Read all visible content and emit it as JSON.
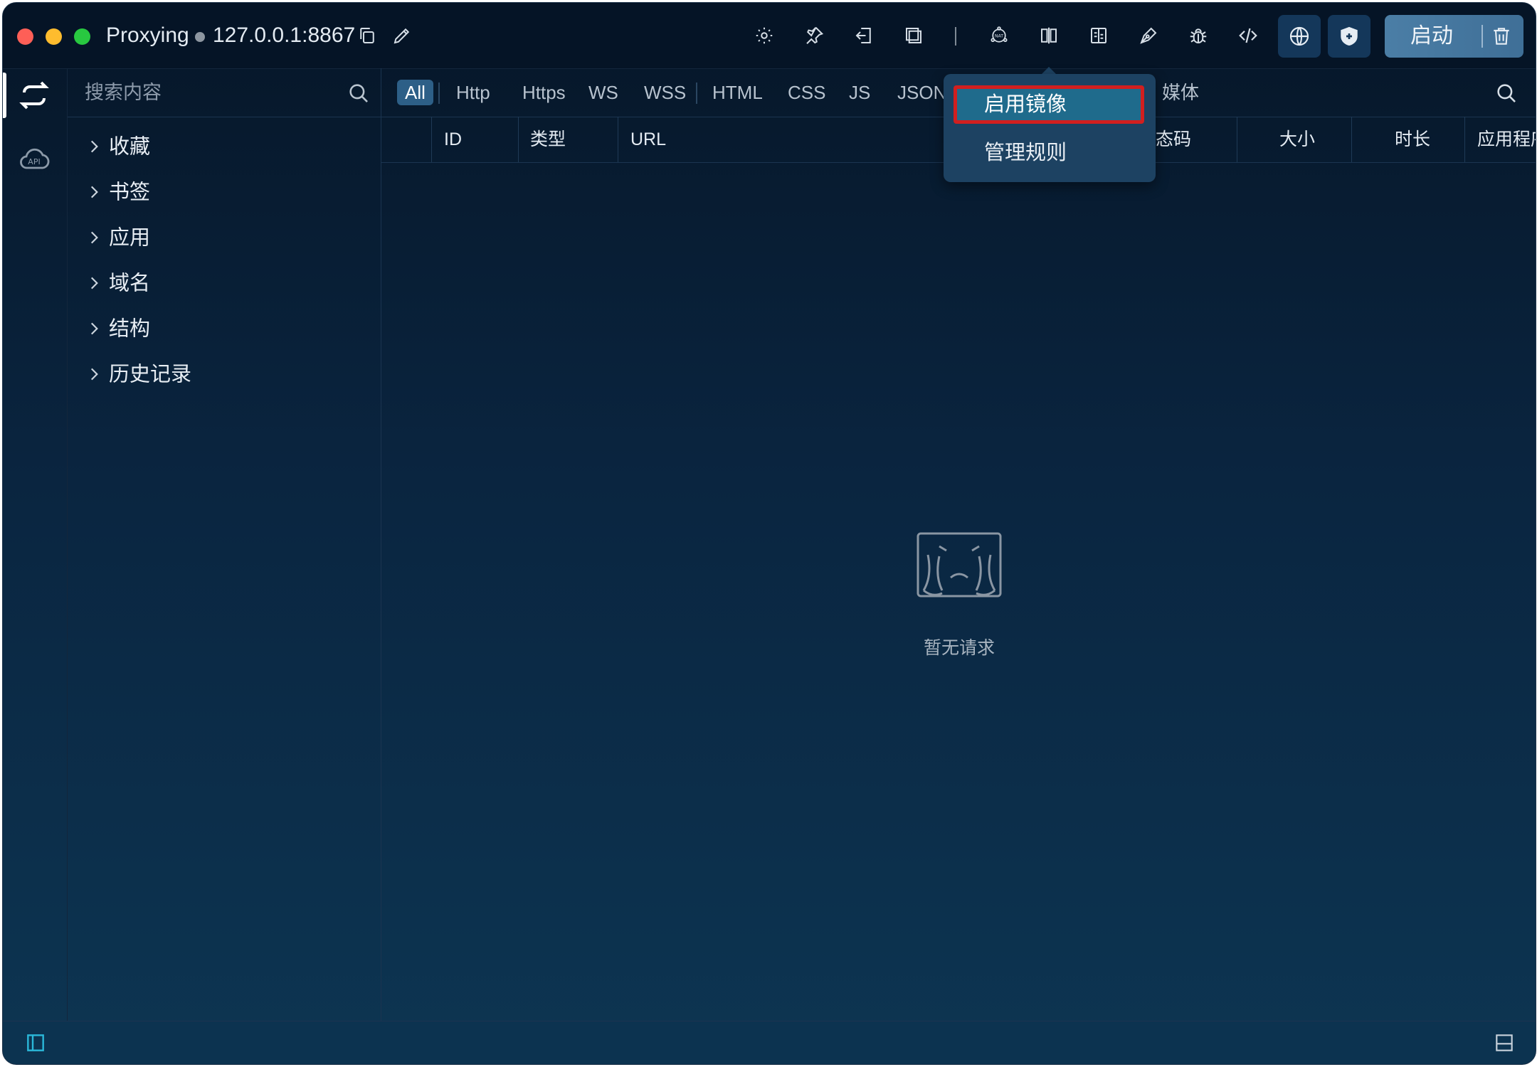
{
  "titlebar": {
    "app_name": "Proxying",
    "address": "127.0.0.1:8867",
    "start_label": "启动"
  },
  "sidebar": {
    "search_placeholder": "搜索内容",
    "items": [
      {
        "label": "收藏"
      },
      {
        "label": "书签"
      },
      {
        "label": "应用"
      },
      {
        "label": "域名"
      },
      {
        "label": "结构"
      },
      {
        "label": "历史记录"
      }
    ]
  },
  "filters": {
    "tabs": [
      "All",
      "Http",
      "Https",
      "WS",
      "WSS",
      "HTML",
      "CSS",
      "JS",
      "JSON",
      "媒体"
    ],
    "active": "All"
  },
  "table": {
    "columns": [
      "ID",
      "类型",
      "URL",
      "态码",
      "大小",
      "时长",
      "应用程序"
    ]
  },
  "empty_state": {
    "text": "暂无请求"
  },
  "dropdown": {
    "items": [
      "启用镜像",
      "管理规则"
    ],
    "highlighted": "启用镜像"
  },
  "colors": {
    "highlight_border": "#d21f1f",
    "active_tab": "#2d5f87",
    "background_top": "#061628",
    "background_bottom": "#0d3552"
  }
}
